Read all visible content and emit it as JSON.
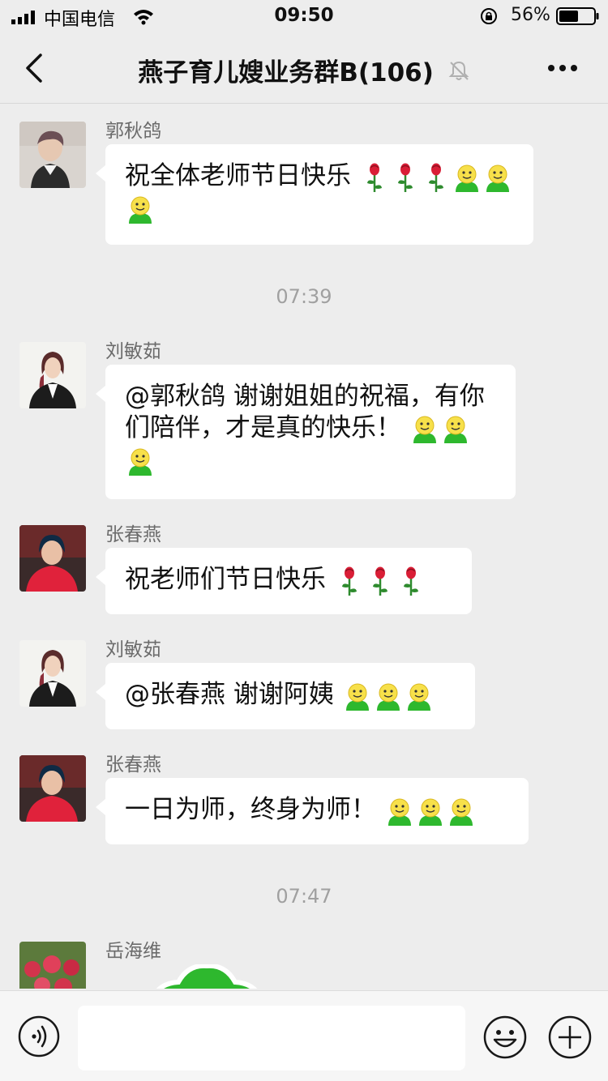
{
  "status_bar": {
    "carrier": "中国电信",
    "time": "09:50",
    "battery_percent": "56%",
    "battery_level": 0.56
  },
  "nav": {
    "title": "燕子育儿嫂业务群B(106)",
    "back_icon": "chevron-left-icon",
    "mute_icon": "bell-muted-icon",
    "more_icon": "more-dots-icon"
  },
  "messages": [
    {
      "sender": "郭秋鸽",
      "text": "祝全体老师节日快乐",
      "emoji": [
        "rose",
        "rose",
        "rose",
        "smiley",
        "smiley",
        "smiley"
      ]
    },
    {
      "timestamp": "07:39"
    },
    {
      "sender": "刘敏茹",
      "text": "@郭秋鸽 谢谢姐姐的祝福，有你们陪伴，才是真的快乐！",
      "emoji": [
        "smiley",
        "smiley",
        "smiley"
      ]
    },
    {
      "sender": "张春燕",
      "text": "祝老师们节日快乐",
      "emoji": [
        "rose",
        "rose",
        "rose"
      ]
    },
    {
      "sender": "刘敏茹",
      "text": "@张春燕 谢谢阿姨",
      "emoji": [
        "smiley",
        "smiley",
        "smiley"
      ]
    },
    {
      "sender": "张春燕",
      "text": "一日为师，终身为师！",
      "emoji": [
        "smiley",
        "smiley",
        "smiley"
      ]
    },
    {
      "timestamp": "07:47"
    },
    {
      "sender": "岳海维",
      "sticker": "green-sticker"
    }
  ],
  "input_bar": {
    "voice_icon": "voice-icon",
    "emoji_icon": "emoji-icon",
    "plus_icon": "plus-circle-icon",
    "input_value": ""
  },
  "colors": {
    "background": "#ededed",
    "bubble": "#ffffff",
    "sender_text": "#6b6b6b",
    "timestamp_text": "#a0a0a0",
    "sticker_green": "#2eb82e"
  }
}
